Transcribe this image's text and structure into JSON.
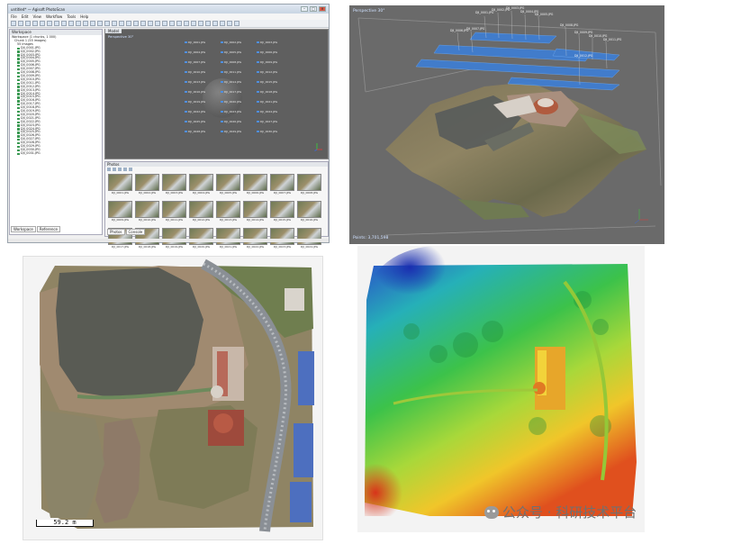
{
  "photoscan": {
    "window_title": "untitled* — Agisoft PhotoScan",
    "menu": [
      "File",
      "Edit",
      "View",
      "Workflow",
      "Tools",
      "Help"
    ],
    "workspace_title": "Workspace",
    "tree": {
      "workspace": "Workspace (1 chunks, 1 000)",
      "chunk": "Chunk 1 (55 images)",
      "cameras": "55 images",
      "images": [
        "DJI_0001.JPG",
        "DJI_0002.JPG",
        "DJI_0003.JPG",
        "DJI_0004.JPG",
        "DJI_0005.JPG",
        "DJI_0006.JPG",
        "DJI_0007.JPG",
        "DJI_0008.JPG",
        "DJI_0009.JPG",
        "DJI_0010.JPG",
        "DJI_0011.JPG",
        "DJI_0012.JPG",
        "DJI_0013.JPG",
        "DJI_0014.JPG",
        "DJI_0015.JPG",
        "DJI_0016.JPG",
        "DJI_0017.JPG",
        "DJI_0018.JPG",
        "DJI_0019.JPG",
        "DJI_0020.JPG",
        "DJI_0021.JPG",
        "DJI_0022.JPG",
        "DJI_0023.JPG",
        "DJI_0024.JPG",
        "DJI_0025.JPG",
        "DJI_0026.JPG",
        "DJI_0027.JPG",
        "DJI_0028.JPG",
        "DJI_0029.JPG",
        "DJI_0030.JPG",
        "DJI_0031.JPG"
      ]
    },
    "side_tabs": [
      "Workspace",
      "Reference"
    ],
    "model_tab": "Model",
    "model_label": "Perspective 30°",
    "cam_labels": [
      "DJI_0001.JPG",
      "DJI_0002.JPG",
      "DJI_0003.JPG",
      "DJI_0004.JPG",
      "DJI_0005.JPG",
      "DJI_0006.JPG",
      "DJI_0007.JPG",
      "DJI_0008.JPG",
      "DJI_0009.JPG",
      "DJI_0010.JPG",
      "DJI_0011.JPG",
      "DJI_0012.JPG",
      "DJI_0013.JPG",
      "DJI_0014.JPG",
      "DJI_0015.JPG",
      "DJI_0016.JPG",
      "DJI_0017.JPG",
      "DJI_0018.JPG",
      "DJI_0019.JPG",
      "DJI_0020.JPG",
      "DJI_0021.JPG",
      "DJI_0022.JPG",
      "DJI_0023.JPG",
      "DJI_0024.JPG",
      "DJI_0025.JPG",
      "DJI_0026.JPG",
      "DJI_0027.JPG",
      "DJI_0028.JPG",
      "DJI_0029.JPG",
      "DJI_0030.JPG"
    ],
    "photos_title": "Photos",
    "thumbs": [
      "DJI_0001.JPG",
      "DJI_0002.JPG",
      "DJI_0003.JPG",
      "DJI_0004.JPG",
      "DJI_0005.JPG",
      "DJI_0006.JPG",
      "DJI_0007.JPG",
      "DJI_0008.JPG",
      "DJI_0009.JPG",
      "DJI_0010.JPG",
      "DJI_0011.JPG",
      "DJI_0012.JPG",
      "DJI_0013.JPG",
      "DJI_0014.JPG",
      "DJI_0015.JPG",
      "DJI_0016.JPG",
      "DJI_0017.JPG",
      "DJI_0018.JPG",
      "DJI_0019.JPG",
      "DJI_0020.JPG",
      "DJI_0021.JPG",
      "DJI_0022.JPG",
      "DJI_0023.JPG",
      "DJI_0024.JPG"
    ],
    "photos_tabs": [
      "Photos",
      "Console"
    ]
  },
  "perspective_view": {
    "label": "Perspective 30°",
    "points": "Points: 3,701,598",
    "camera_labels": [
      "DJI_0001.JPG",
      "DJI_0002.JPG",
      "DJI_0003.JPG",
      "DJI_0004.JPG",
      "DJI_0005.JPG",
      "DJI_0006.JPG",
      "DJI_0007.JPG",
      "DJI_0008.JPG",
      "DJI_0009.JPG",
      "DJI_0010.JPG",
      "DJI_0011.JPG",
      "DJI_0012.JPG"
    ]
  },
  "orthomosaic": {
    "scale_label": "59.2 m"
  },
  "watermark": "公众号 · 科研技术平台",
  "colors": {
    "window_bg": "#f0f0f0",
    "model_bg": "#5f5f5f",
    "camera_blue": "#4f8fe0",
    "dem_high": "#d83a1c",
    "dem_low": "#1a3fbf"
  }
}
